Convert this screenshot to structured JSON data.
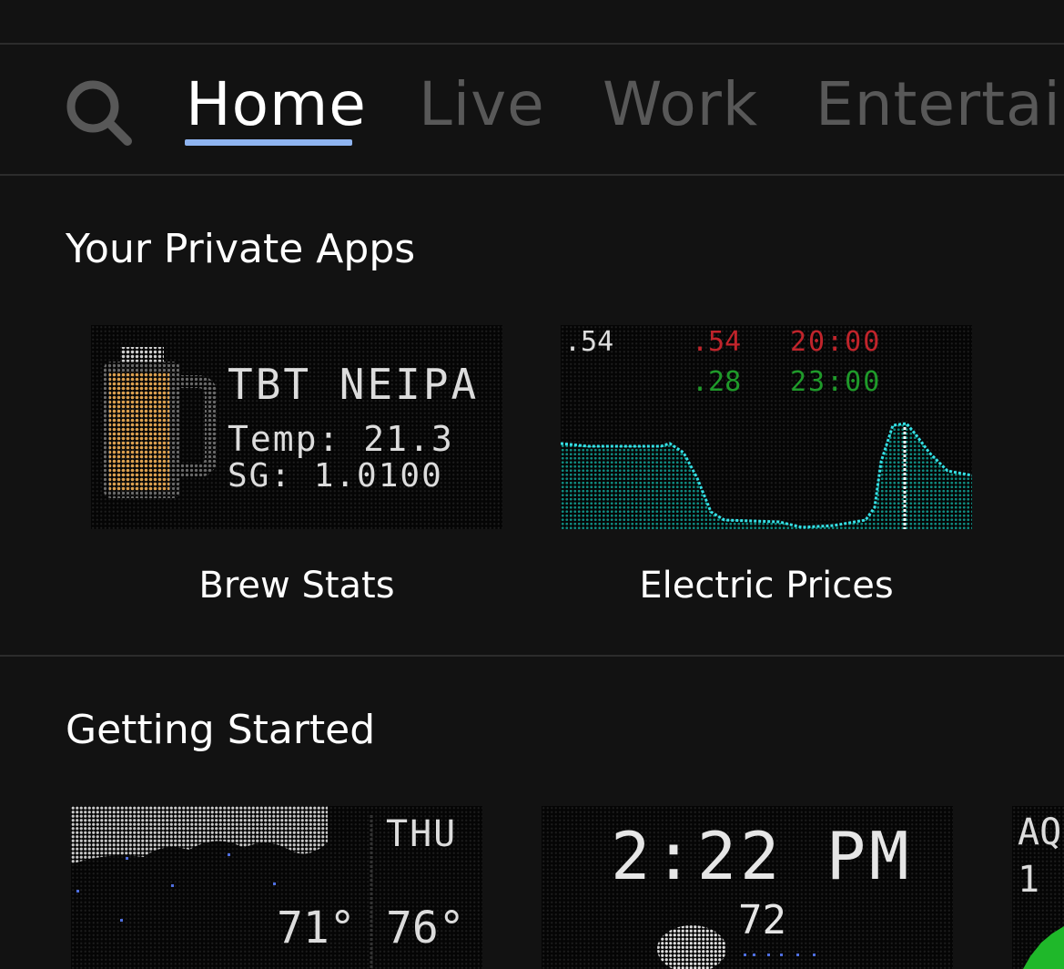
{
  "nav": {
    "search_icon": "search-icon",
    "tabs": [
      {
        "label": "Home",
        "active": true
      },
      {
        "label": "Live",
        "active": false
      },
      {
        "label": "Work",
        "active": false
      },
      {
        "label": "Entertain",
        "active": false
      }
    ]
  },
  "sections": {
    "private": {
      "title": "Your Private Apps",
      "apps": [
        {
          "name": "Brew Stats",
          "display": {
            "line1": "TBT NEIPA",
            "line2": "Temp: 21.3",
            "line3": "SG: 1.0100",
            "icon": "beer-mug-icon"
          }
        },
        {
          "name": "Electric Prices",
          "display": {
            "current": ".54",
            "high_price": ".54",
            "high_time": "20:00",
            "low_price": ".28",
            "low_time": "23:00"
          }
        }
      ]
    },
    "getting_started": {
      "title": "Getting Started",
      "apps": [
        {
          "display": {
            "day": "THU",
            "temp_now": "71°",
            "temp_high": "76°"
          }
        },
        {
          "display": {
            "time": "2:22 PM",
            "temp": "72"
          }
        },
        {
          "display": {
            "line1": "AQ",
            "line2": "1"
          }
        }
      ]
    }
  },
  "colors": {
    "accent": "#8fb4f0",
    "price_high": "#c0242b",
    "price_low": "#1f9a2a",
    "chart_line": "#35e0e6",
    "chart_fill": "#0e7d74"
  }
}
